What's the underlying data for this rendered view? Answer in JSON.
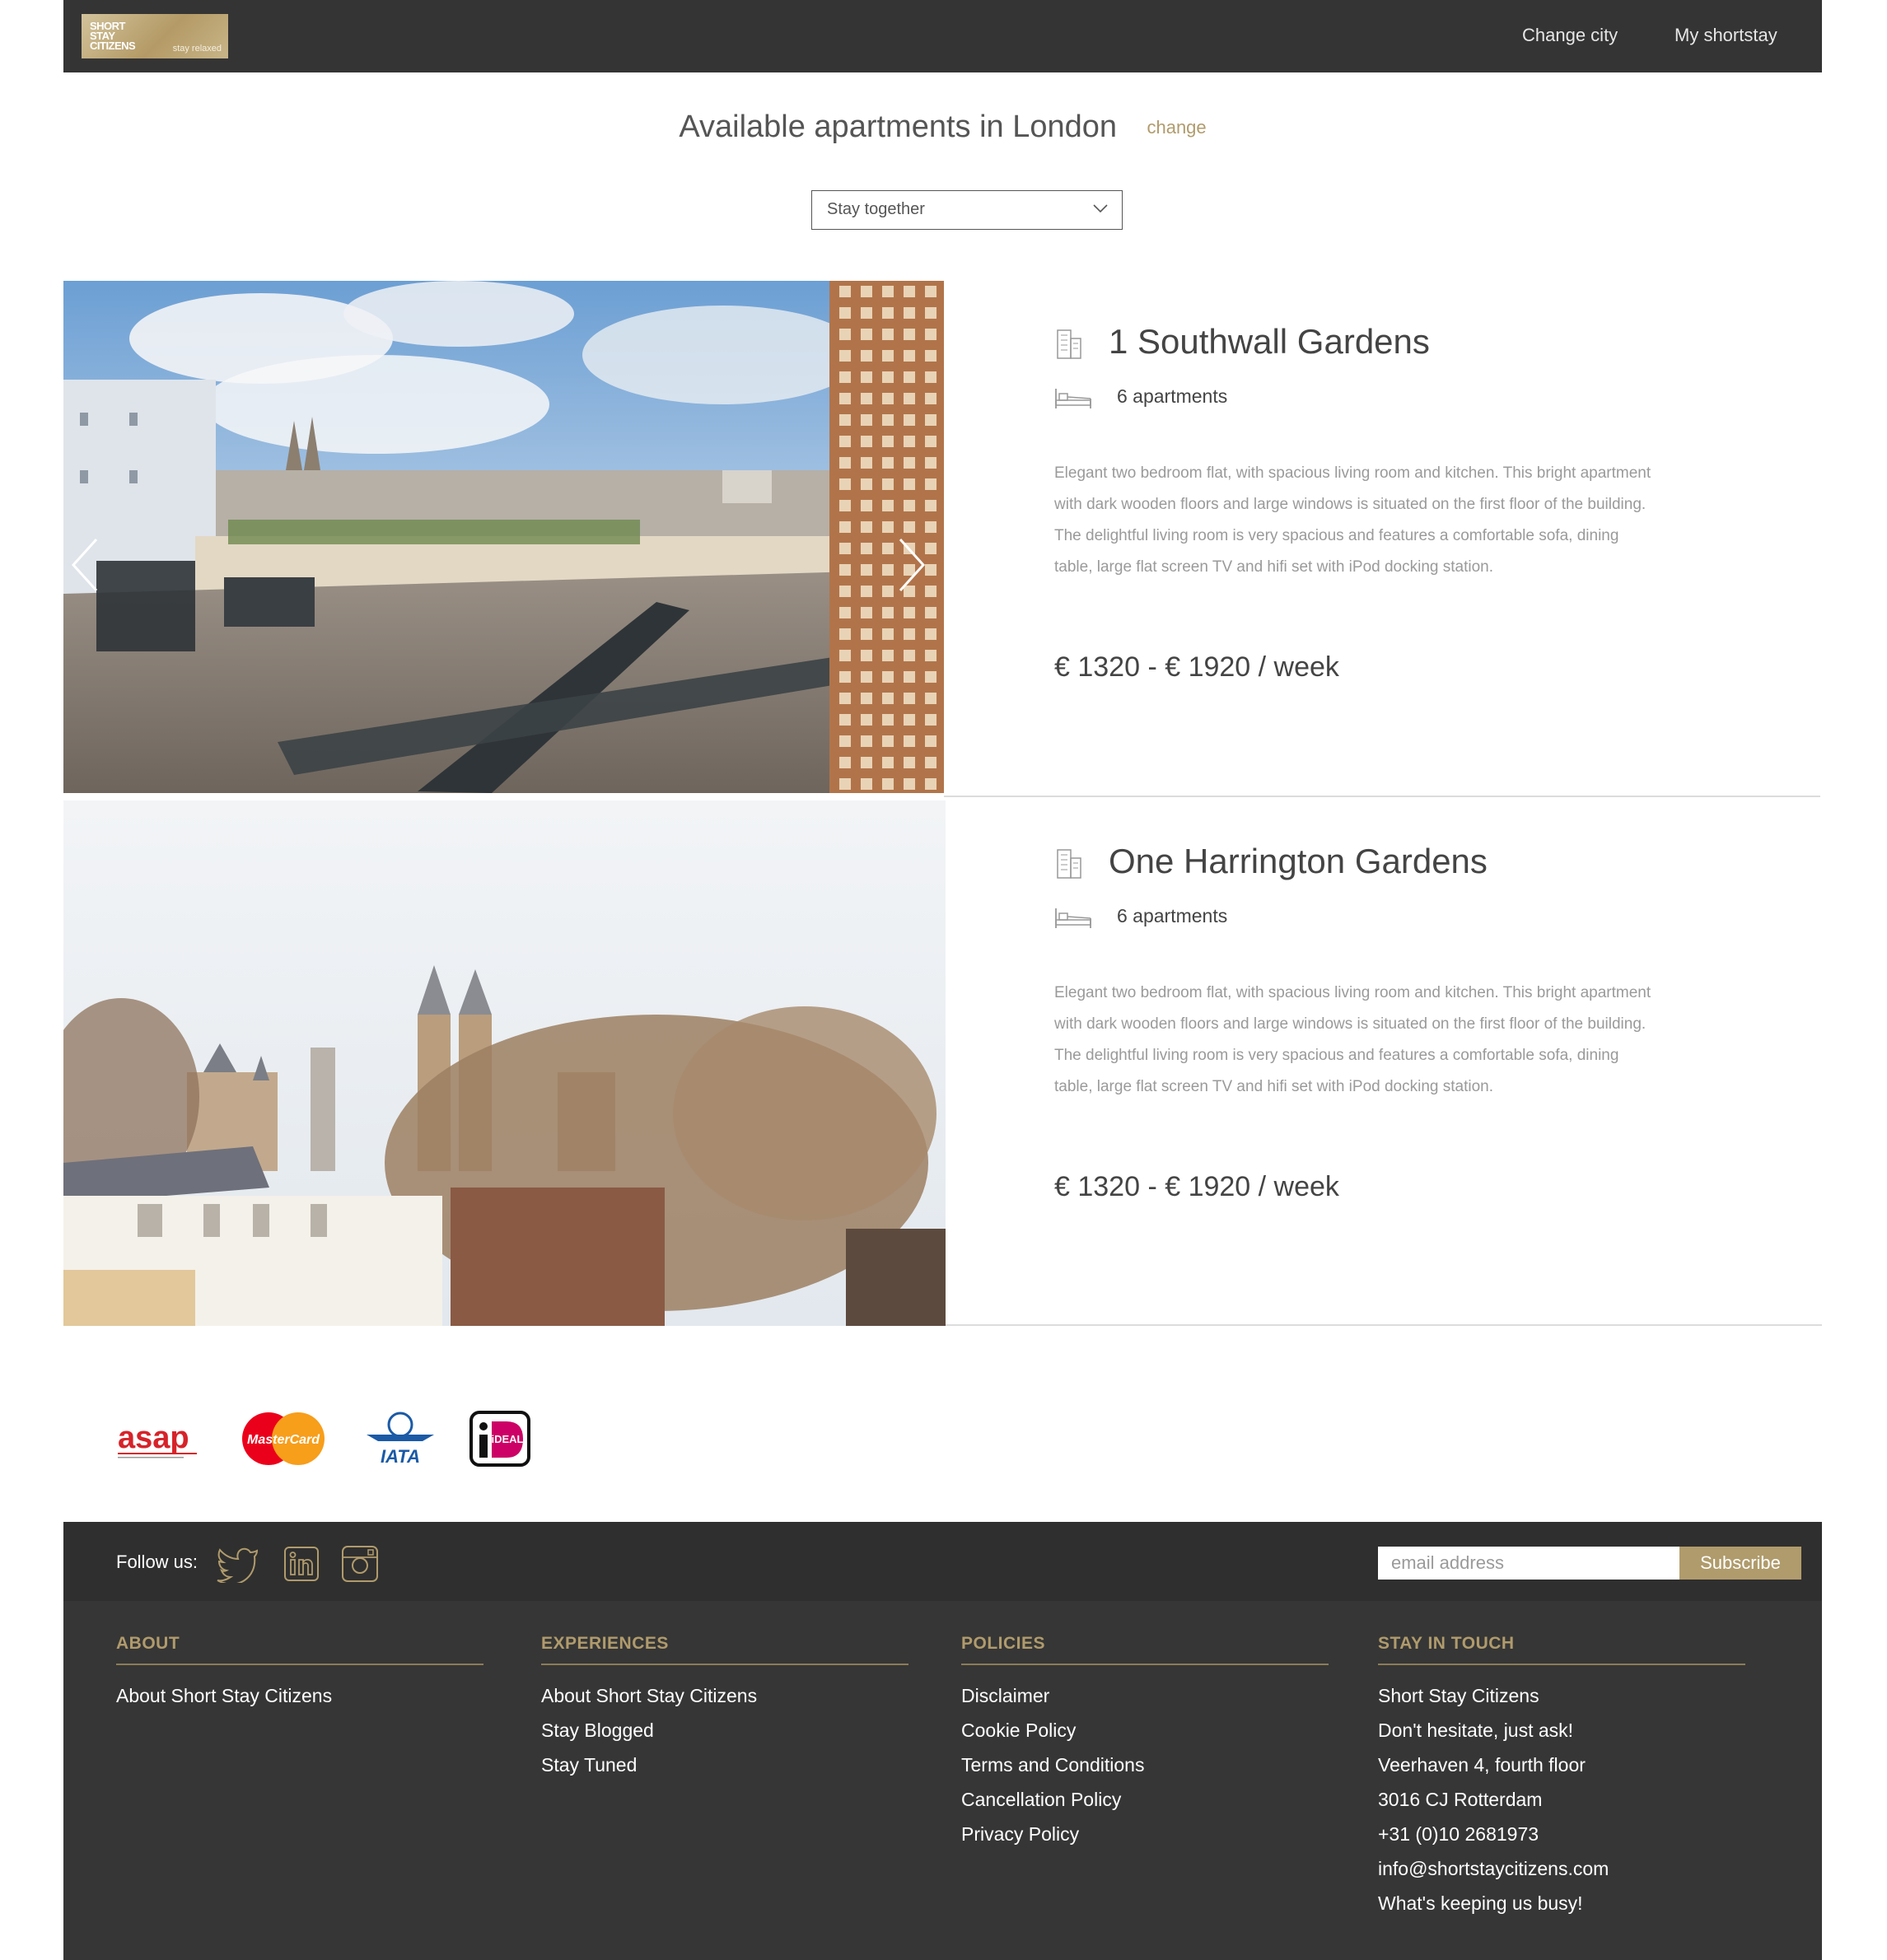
{
  "nav": {
    "logo_words": "SHORT STAY CITIZENS",
    "logo_tagline": "stay relaxed",
    "change_city": "Change city",
    "my_shortstay": "My shortstay"
  },
  "heading": {
    "title": "Available apartments in London",
    "change": "change"
  },
  "filter": {
    "selected": "Stay together"
  },
  "listings": [
    {
      "name": "1 Southwall Gardens",
      "apartments": "6 apartments",
      "description": "Elegant two bedroom flat, with spacious living room and kitchen. This bright apartment with dark wooden floors and large windows is situated on the first floor of the building. The delightful living room is very spacious and features a comfortable sofa, dining table, large flat screen TV and hifi set with iPod docking station.",
      "price": "€ 1320  -  € 1920 / week"
    },
    {
      "name": "One Harrington Gardens",
      "apartments": "6 apartments",
      "description": "Elegant two bedroom flat, with spacious living room and kitchen. This bright apartment with dark wooden floors and large windows is situated on the first floor of the building. The delightful living room is very spacious and features a comfortable sofa, dining table, large flat screen TV and hifi set with iPod docking station.",
      "price": "€ 1320  -  € 1920 / week"
    }
  ],
  "payments": {
    "asap": "asap",
    "mastercard": "MasterCard",
    "iata": "IATA",
    "ideal": "iDEAL"
  },
  "footer": {
    "follow": "Follow us:",
    "email_placeholder": "email address",
    "subscribe": "Subscribe",
    "columns": [
      {
        "title": "ABOUT",
        "items": [
          "About Short Stay Citizens"
        ]
      },
      {
        "title": "EXPERIENCES",
        "items": [
          "About Short Stay Citizens",
          "Stay Blogged",
          "Stay Tuned"
        ]
      },
      {
        "title": "POLICIES",
        "items": [
          "Disclaimer",
          "Cookie Policy",
          "Terms and Conditions",
          "Cancellation Policy",
          "Privacy Policy"
        ]
      },
      {
        "title": "STAY IN TOUCH",
        "items": [
          "Short Stay Citizens",
          "Don't hesitate, just ask!",
          "Veerhaven 4, fourth floor",
          "3016 CJ Rotterdam",
          "+31 (0)10 2681973",
          "info@shortstaycitizens.com",
          "What's keeping us busy!"
        ]
      }
    ]
  },
  "colors": {
    "accent": "#b09b6c",
    "dark": "#343434"
  },
  "icons": [
    "building-icon",
    "bed-icon",
    "twitter-icon",
    "linkedin-icon",
    "instagram-icon",
    "chevron-down-icon",
    "chevron-left-icon",
    "chevron-right-icon"
  ]
}
